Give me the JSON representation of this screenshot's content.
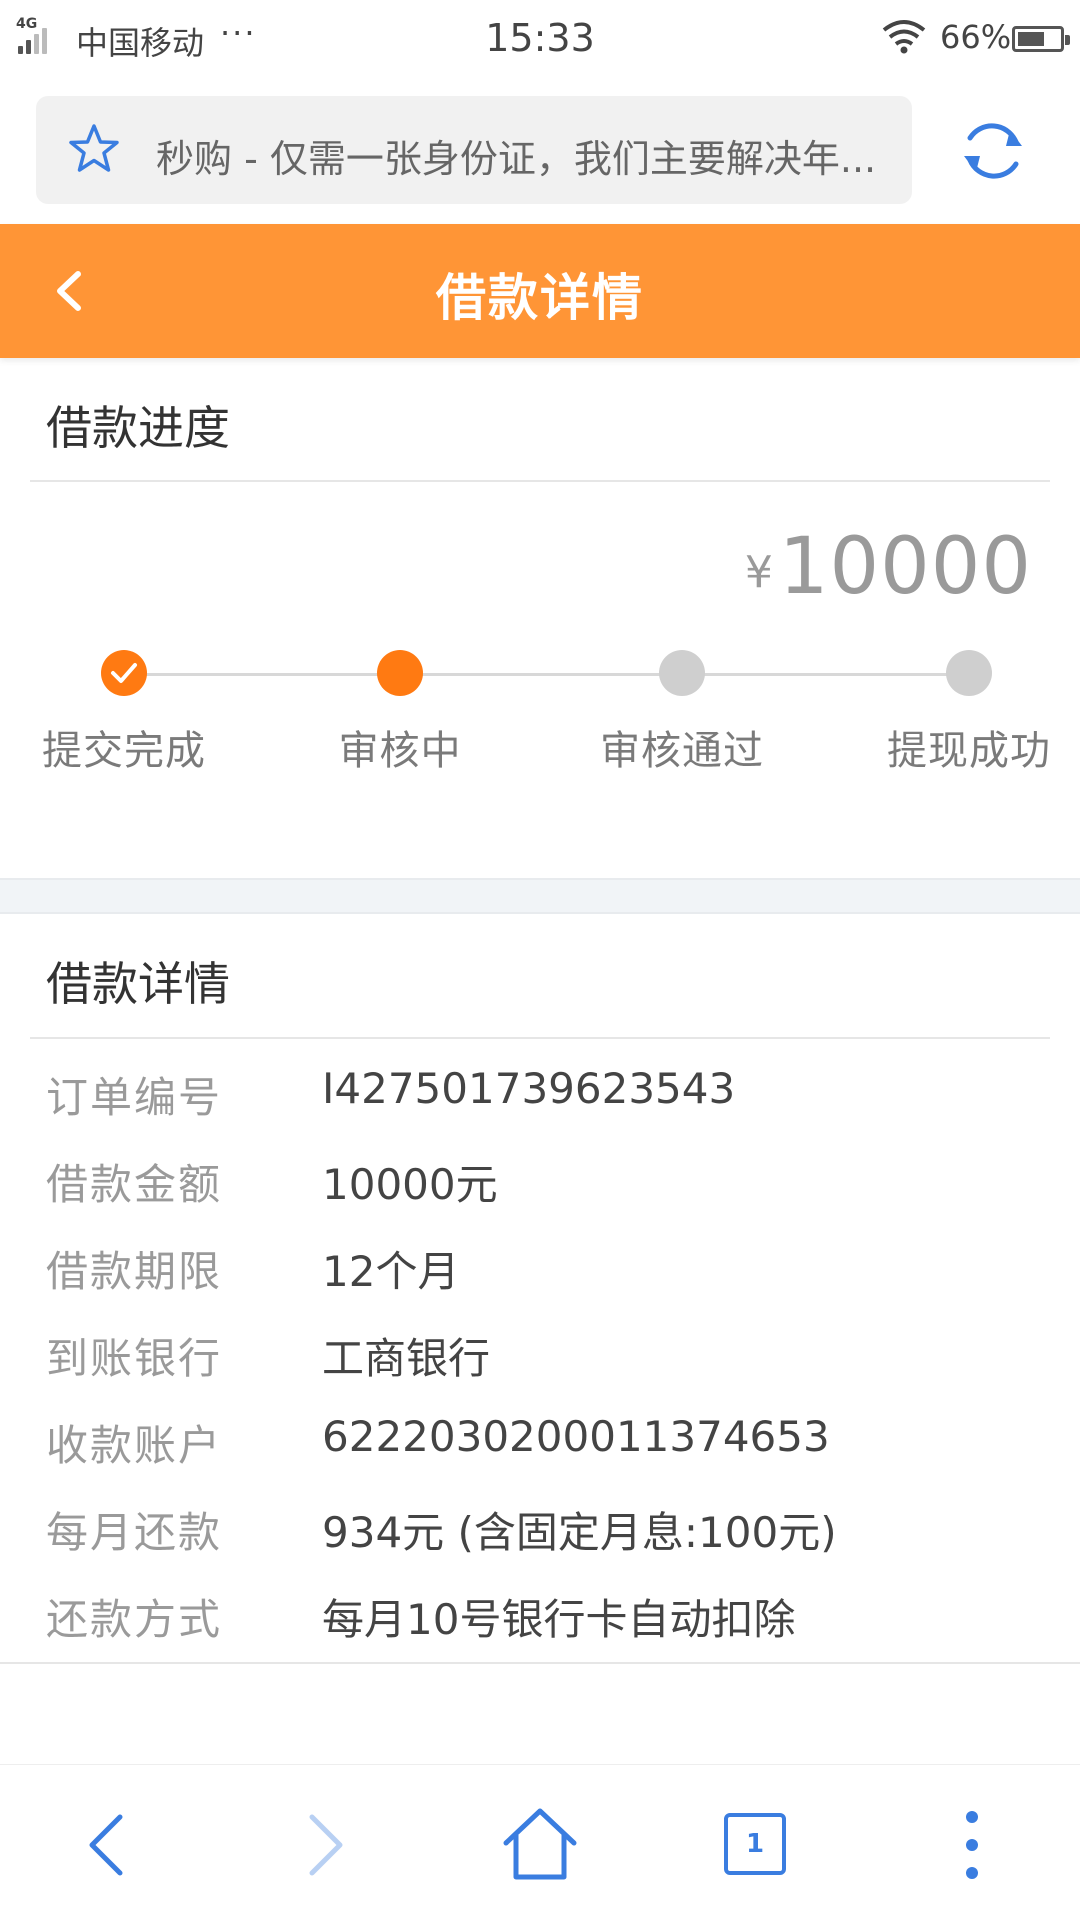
{
  "status_bar": {
    "network": "4G",
    "carrier": "中国移动",
    "more": "···",
    "time": "15:33",
    "battery_percent": "66%",
    "battery_level": 0.66
  },
  "browser": {
    "url_text": "秒购 - 仅需一张身份证，我们主要解决年...",
    "star_icon": "star-icon",
    "refresh_icon": "refresh-icon"
  },
  "header": {
    "title": "借款详情",
    "back_icon": "chevron-left-icon",
    "background": "#ff9536"
  },
  "progress": {
    "section_title": "借款进度",
    "currency": "¥",
    "amount": "10000",
    "accent": "#ff7a12",
    "steps": [
      {
        "label": "提交完成",
        "state": "done"
      },
      {
        "label": "审核中",
        "state": "active"
      },
      {
        "label": "审核通过",
        "state": "pending"
      },
      {
        "label": "提现成功",
        "state": "pending"
      }
    ]
  },
  "details": {
    "section_title": "借款详情",
    "rows": [
      {
        "key": "订单编号",
        "value": "I427501739623543"
      },
      {
        "key": "借款金额",
        "value": "10000元"
      },
      {
        "key": "借款期限",
        "value": "12个月"
      },
      {
        "key": "到账银行",
        "value": "工商银行"
      },
      {
        "key": "收款账户",
        "value": "6222030200011374653"
      },
      {
        "key": "每月还款",
        "value": "934元 (含固定月息:100元)"
      },
      {
        "key": "还款方式",
        "value": "每月10号银行卡自动扣除"
      }
    ]
  },
  "bottom_nav": {
    "tab_count": "1",
    "icons": [
      "back-arrow-icon",
      "forward-arrow-icon",
      "home-icon",
      "tabs-icon",
      "more-icon"
    ],
    "color": "#3a7de0"
  }
}
